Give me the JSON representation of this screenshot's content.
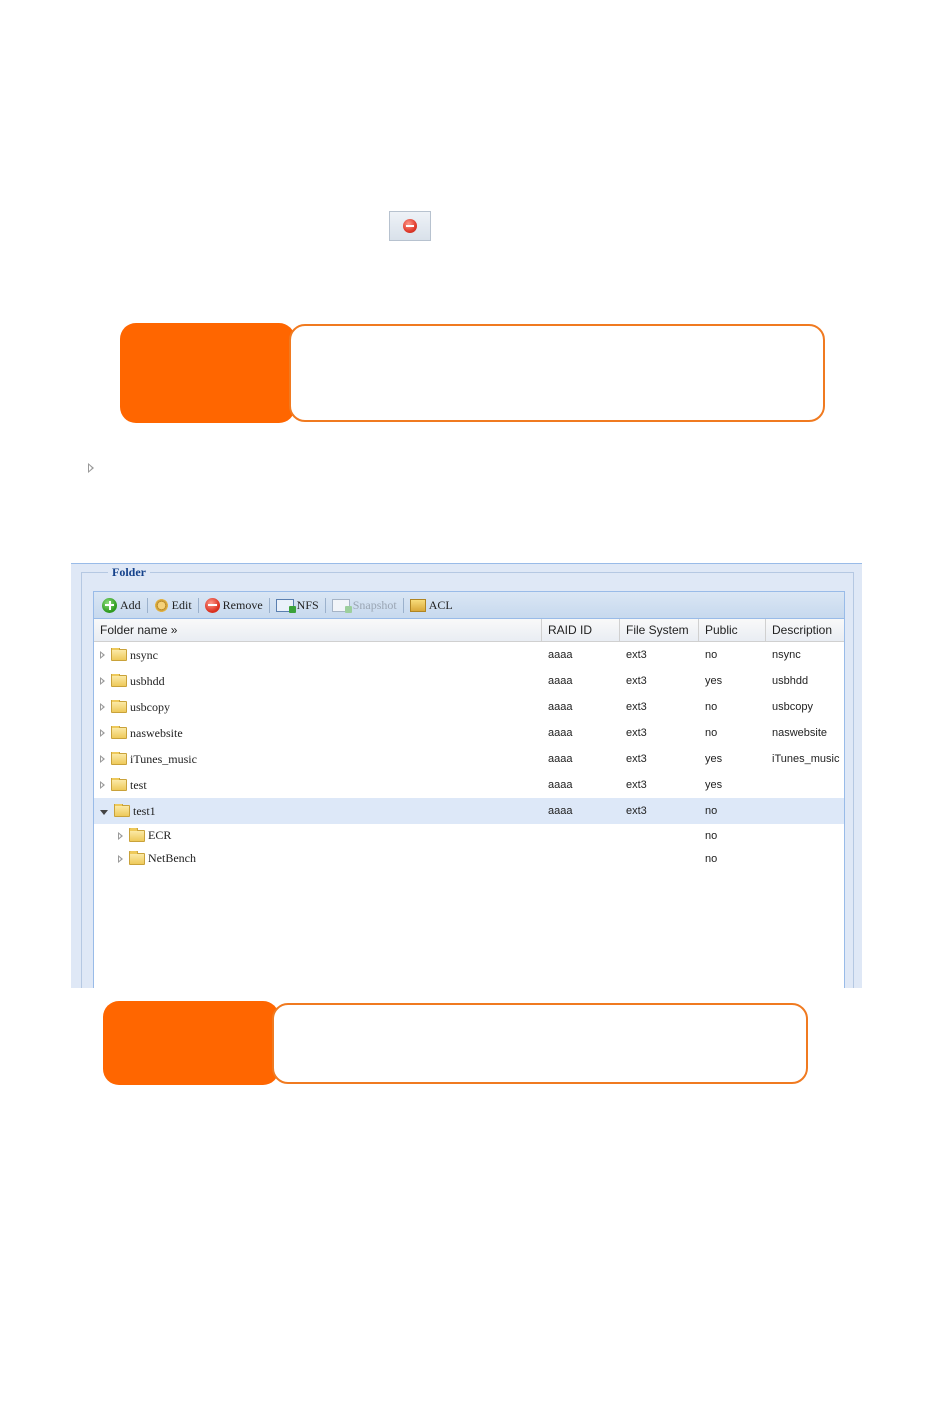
{
  "folder_panel": {
    "legend": "Folder",
    "toolbar": {
      "add": "Add",
      "edit": "Edit",
      "remove": "Remove",
      "nfs": "NFS",
      "snapshot": "Snapshot",
      "acl": "ACL"
    },
    "columns": {
      "name": "Folder name »",
      "raid_id": "RAID ID",
      "file_system": "File System",
      "public": "Public",
      "description": "Description"
    },
    "rows": [
      {
        "name": "nsync",
        "raid_id": "aaaa",
        "fs": "ext3",
        "public": "no",
        "desc": "nsync"
      },
      {
        "name": "usbhdd",
        "raid_id": "aaaa",
        "fs": "ext3",
        "public": "yes",
        "desc": "usbhdd"
      },
      {
        "name": "usbcopy",
        "raid_id": "aaaa",
        "fs": "ext3",
        "public": "no",
        "desc": "usbcopy"
      },
      {
        "name": "naswebsite",
        "raid_id": "aaaa",
        "fs": "ext3",
        "public": "no",
        "desc": "naswebsite"
      },
      {
        "name": "iTunes_music",
        "raid_id": "aaaa",
        "fs": "ext3",
        "public": "yes",
        "desc": "iTunes_music"
      },
      {
        "name": "test",
        "raid_id": "aaaa",
        "fs": "ext3",
        "public": "yes",
        "desc": ""
      },
      {
        "name": "test1",
        "raid_id": "aaaa",
        "fs": "ext3",
        "public": "no",
        "desc": ""
      }
    ],
    "subrows": [
      {
        "name": "ECR",
        "public": "no"
      },
      {
        "name": "NetBench",
        "public": "no"
      }
    ]
  }
}
